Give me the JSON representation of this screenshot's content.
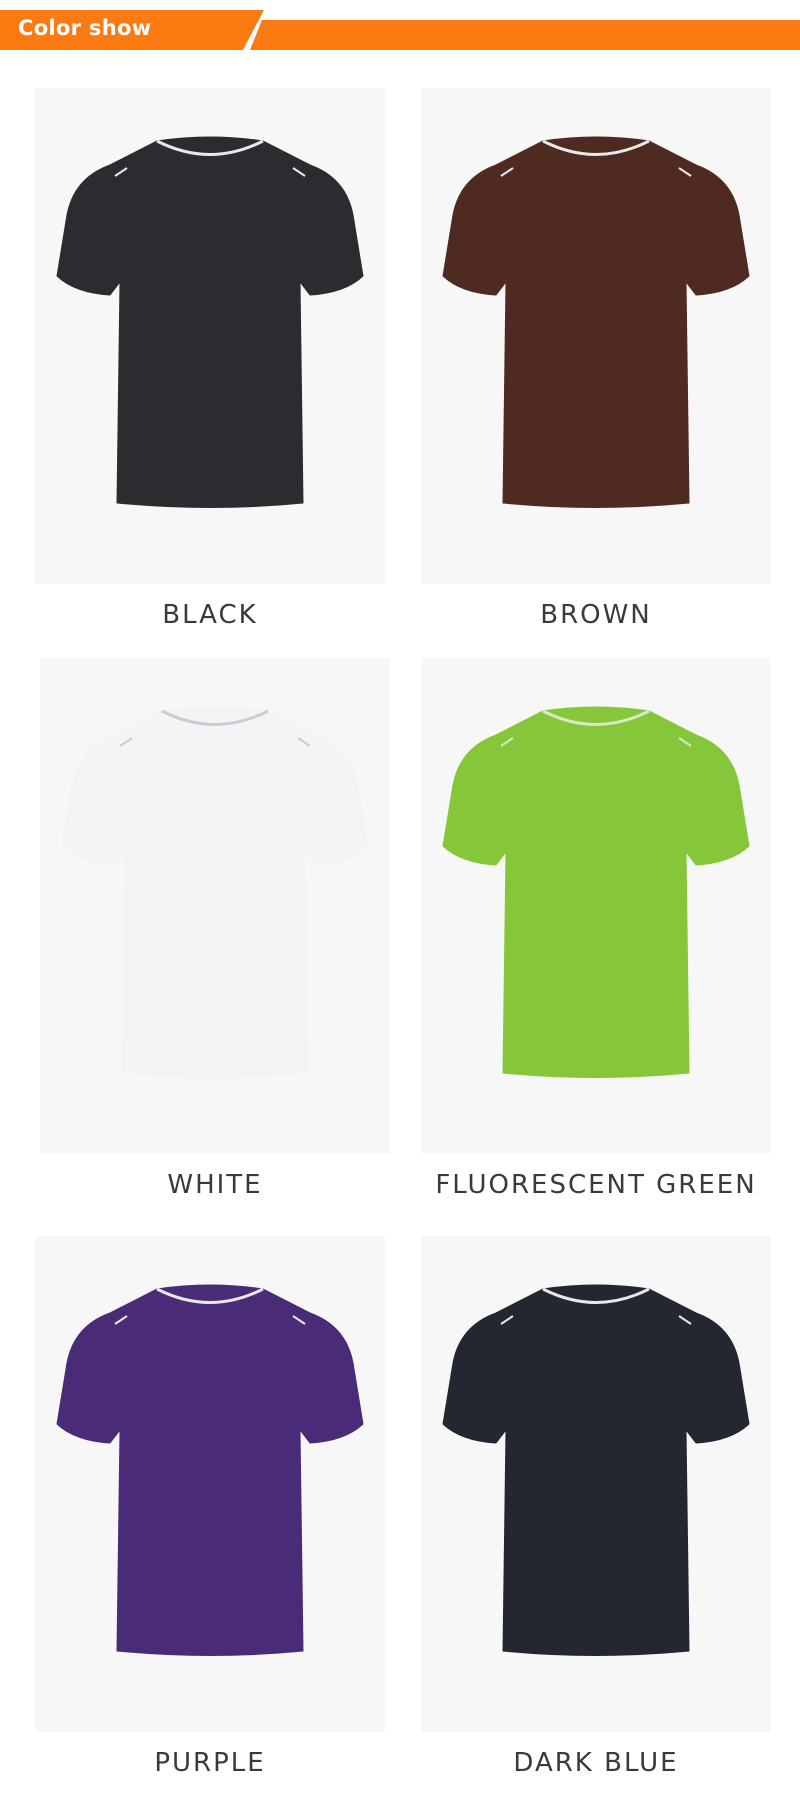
{
  "header": {
    "title": "Color show",
    "accent_color": "#fb7a11"
  },
  "colors": [
    {
      "name": "BLACK",
      "shirt_color": "#2b2c30",
      "stripe_color": "#e8e8e8"
    },
    {
      "name": "BROWN",
      "shirt_color": "#4f2a20",
      "stripe_color": "#e8e8e8"
    },
    {
      "name": "WHITE",
      "shirt_color": "#f3f4f6",
      "stripe_color": "#c9ccd2"
    },
    {
      "name": "FLUORESCENT GREEN",
      "shirt_color": "#86c73a",
      "stripe_color": "#d9e8c7"
    },
    {
      "name": "PURPLE",
      "shirt_color": "#4a2b78",
      "stripe_color": "#e8e8e8"
    },
    {
      "name": "DARK BLUE",
      "shirt_color": "#23272f",
      "stripe_color": "#e8e8e8"
    }
  ]
}
